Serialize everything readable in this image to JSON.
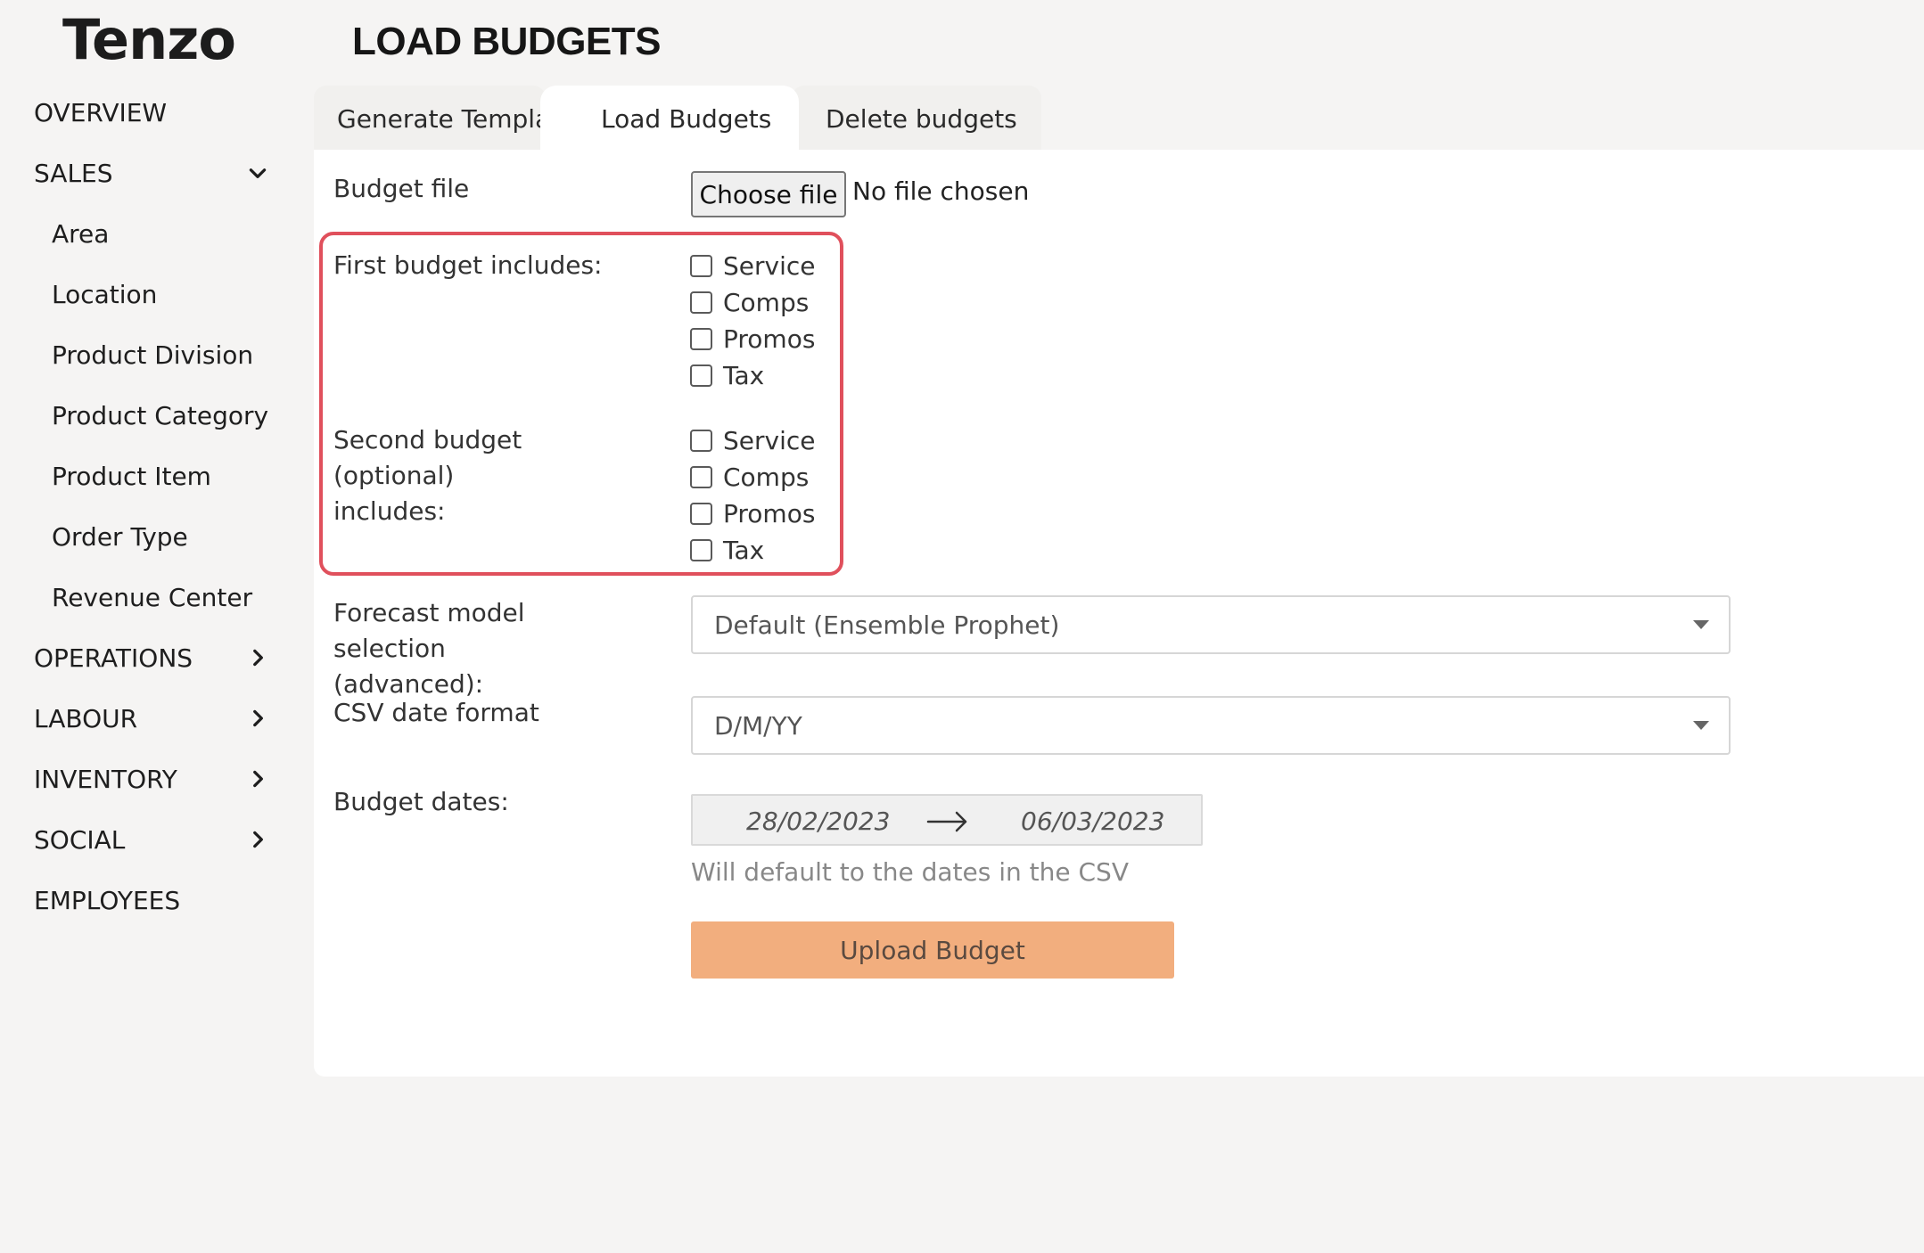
{
  "app": {
    "logo_text": "Tenzo",
    "page_title": "LOAD BUDGETS"
  },
  "sidebar": {
    "items": [
      {
        "label": "OVERVIEW",
        "level": "top",
        "chevron": "none"
      },
      {
        "label": "SALES",
        "level": "top",
        "chevron": "down"
      },
      {
        "label": "Area",
        "level": "sub",
        "chevron": "none"
      },
      {
        "label": "Location",
        "level": "sub",
        "chevron": "none"
      },
      {
        "label": "Product Division",
        "level": "sub",
        "chevron": "none"
      },
      {
        "label": "Product Category",
        "level": "sub",
        "chevron": "none"
      },
      {
        "label": "Product Item",
        "level": "sub",
        "chevron": "none"
      },
      {
        "label": "Order Type",
        "level": "sub",
        "chevron": "none"
      },
      {
        "label": "Revenue Center",
        "level": "sub",
        "chevron": "none"
      },
      {
        "label": "OPERATIONS",
        "level": "top",
        "chevron": "right"
      },
      {
        "label": "LABOUR",
        "level": "top",
        "chevron": "right"
      },
      {
        "label": "INVENTORY",
        "level": "top",
        "chevron": "right"
      },
      {
        "label": "SOCIAL",
        "level": "top",
        "chevron": "right"
      },
      {
        "label": "EMPLOYEES",
        "level": "top",
        "chevron": "none"
      }
    ]
  },
  "tabs": [
    {
      "label": "Generate Templa",
      "active": false
    },
    {
      "label": "Load Budgets",
      "active": true
    },
    {
      "label": "Delete budgets",
      "active": false
    }
  ],
  "form": {
    "budget_file": {
      "label": "Budget file",
      "button": "Choose file",
      "status": "No file chosen"
    },
    "first_budget": {
      "label": "First budget includes:",
      "options": [
        "Service",
        "Comps",
        "Promos",
        "Tax"
      ]
    },
    "second_budget": {
      "label_line1": "Second budget (optional)",
      "label_line2": "includes:",
      "options": [
        "Service",
        "Comps",
        "Promos",
        "Tax"
      ]
    },
    "forecast_model": {
      "label_line1": "Forecast model selection",
      "label_line2": "(advanced):",
      "value": "Default (Ensemble Prophet)"
    },
    "csv_date_format": {
      "label": "CSV date format",
      "value": "D/M/YY"
    },
    "budget_dates": {
      "label": "Budget dates:",
      "start": "28/02/2023",
      "end": "06/03/2023",
      "help": "Will default to the dates in the CSV"
    },
    "upload_button": "Upload Budget"
  },
  "colors": {
    "highlight": "#e0505c",
    "upload_button": "#f2ae7e",
    "background": "#f5f4f3"
  }
}
